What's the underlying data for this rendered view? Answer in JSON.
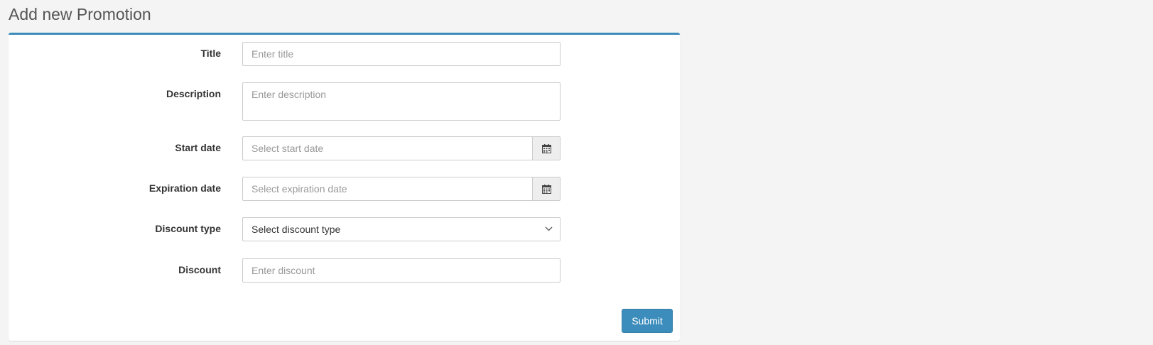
{
  "page": {
    "title": "Add new Promotion"
  },
  "form": {
    "title": {
      "label": "Title",
      "placeholder": "Enter title",
      "value": ""
    },
    "description": {
      "label": "Description",
      "placeholder": "Enter description",
      "value": ""
    },
    "start_date": {
      "label": "Start date",
      "placeholder": "Select start date",
      "value": "",
      "addon_icon": "calendar-icon"
    },
    "expiration_date": {
      "label": "Expiration date",
      "placeholder": "Select expiration date",
      "value": "",
      "addon_icon": "calendar-icon"
    },
    "discount_type": {
      "label": "Discount type",
      "selected": "Select discount type",
      "icon": "chevron-down-icon"
    },
    "discount": {
      "label": "Discount",
      "placeholder": "Enter discount",
      "value": ""
    },
    "submit_label": "Submit"
  },
  "colors": {
    "accent": "#3c8dbc",
    "background": "#f4f4f4",
    "panel": "#ffffff"
  }
}
